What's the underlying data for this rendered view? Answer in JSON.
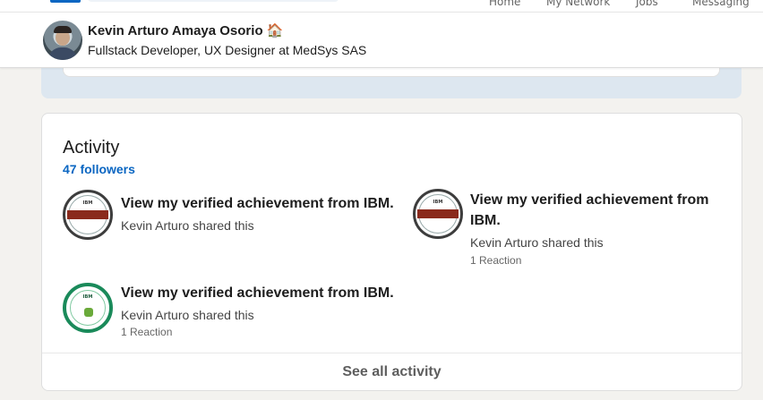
{
  "topnav": {
    "items": [
      "Home",
      "My Network",
      "Jobs",
      "Messaging"
    ]
  },
  "profile": {
    "name": "Kevin Arturo Amaya Osorio 🏠",
    "headline": "Fullstack Developer, UX Designer at MedSys SAS"
  },
  "activity": {
    "title": "Activity",
    "followers": "47 followers",
    "posts": [
      {
        "title": "View my verified achievement from IBM.",
        "shared": "Kevin Arturo shared this",
        "reactions": "",
        "badge": "data-visualization-python-badge",
        "badge_text": "IBM"
      },
      {
        "title_line1": "View my verified achievement from",
        "title_line2": "IBM.",
        "shared": "Kevin Arturo shared this",
        "reactions": "1 Reaction",
        "badge": "data-analysis-python-badge",
        "badge_text": "IBM"
      },
      {
        "title": "View my verified achievement from IBM.",
        "shared": "Kevin Arturo shared this",
        "reactions": "1 Reaction",
        "badge": "python-cognitive-class-badge",
        "badge_text": "IBM"
      }
    ],
    "see_all": "See all activity"
  },
  "colors": {
    "link": "#0a66c2",
    "page_bg": "#f3f2ef",
    "badge_red": "#8a2a1c",
    "badge_green": "#1a8a5a"
  }
}
